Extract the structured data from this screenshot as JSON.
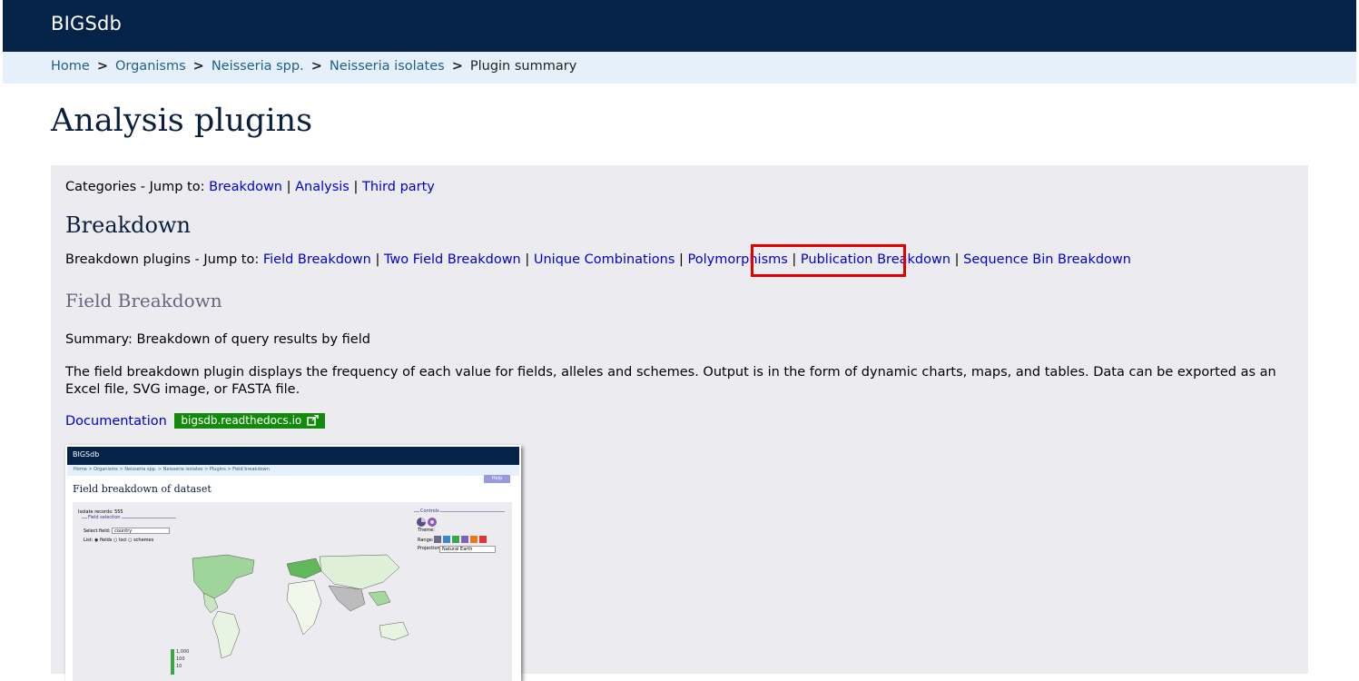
{
  "app": {
    "brand": "BIGSdb"
  },
  "breadcrumb": [
    {
      "label": "Home"
    },
    {
      "label": "Organisms"
    },
    {
      "label": "Neisseria spp."
    },
    {
      "label": "Neisseria isolates"
    },
    {
      "label": "Plugin summary"
    }
  ],
  "breadcrumb_separator": ">",
  "page": {
    "title": "Analysis plugins"
  },
  "categories": {
    "prefix": "Categories - Jump to:",
    "links": [
      "Breakdown",
      "Analysis",
      "Third party"
    ],
    "separator": "|"
  },
  "breakdown": {
    "heading": "Breakdown",
    "prefix": "Breakdown plugins - Jump to:",
    "links": [
      "Field Breakdown",
      "Two Field Breakdown",
      "Unique Combinations",
      "Polymorphisms",
      "Publication Breakdown",
      "Sequence Bin Breakdown"
    ],
    "separator": "|",
    "highlighted": "Publication Breakdown",
    "highlight_color": "#e30000"
  },
  "field_breakdown": {
    "heading": "Field Breakdown",
    "summary": "Summary: Breakdown of query results by field",
    "description": "The field breakdown plugin displays the frequency of each value for fields, alleles and schemes. Output is in the form of dynamic charts, maps, and tables. Data can be exported as an Excel file, SVG image, or FASTA file.",
    "doc_link": "Documentation",
    "doc_badge": "bigsdb.readthedocs.io",
    "doc_badge_icon": "external-link-icon",
    "doc_badge_color": "#138a0c"
  },
  "thumbnail": {
    "brand": "BIGSdb",
    "breadcrumb": "Home  >  Organisms  >  Neisseria spp.  >  Neisseria isolates  >  Plugins  >  Field breakdown",
    "help": "Help",
    "title": "Field breakdown of dataset",
    "isolate_records": "Isolate records: 555",
    "field_selection_legend": "Field selection",
    "select_field_label": "Select field:",
    "select_field_value": "country",
    "list_label": "List:",
    "list_options": [
      "fields",
      "loci",
      "schemes"
    ],
    "controls_legend": "Controls",
    "theme_label": "Theme:",
    "range_label": "Range:",
    "projection_label": "Projection:",
    "projection_value": "Natural Earth",
    "theme_swatches": [
      "#6b6b8a",
      "#3b87c9",
      "#3aa648",
      "#7c64b5",
      "#e87722",
      "#e03530"
    ],
    "legend_values": [
      "1,000",
      "100",
      "10"
    ]
  },
  "colors": {
    "topbar": "#052349",
    "breadcrumb_bg": "#e6f0fb",
    "panel_bg": "#ececf0",
    "link": "#0000cc",
    "heading": "#0a1e3d"
  }
}
